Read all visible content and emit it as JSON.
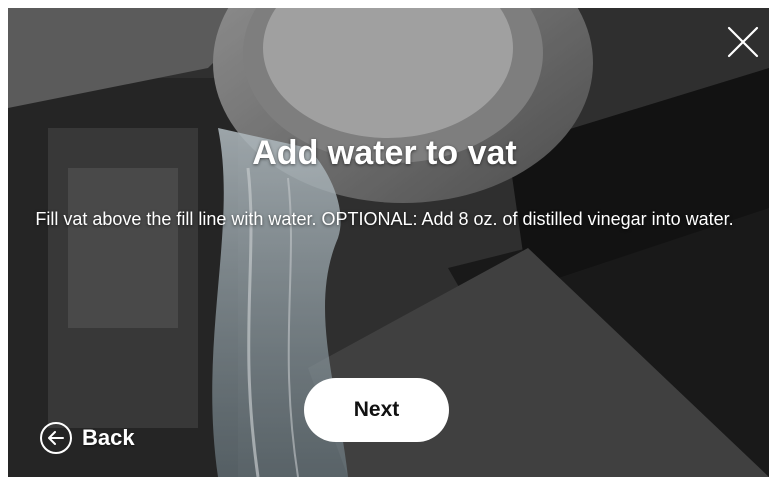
{
  "screen": {
    "title": "Add water to vat",
    "description": "Fill vat above the fill line with water. OPTIONAL: Add 8 oz. of distilled vinegar into water."
  },
  "buttons": {
    "next_label": "Next",
    "back_label": "Back"
  },
  "icons": {
    "close": "close-icon",
    "back": "arrow-left-circle-icon"
  },
  "background_photo": "water-pouring-into-vat-photo"
}
